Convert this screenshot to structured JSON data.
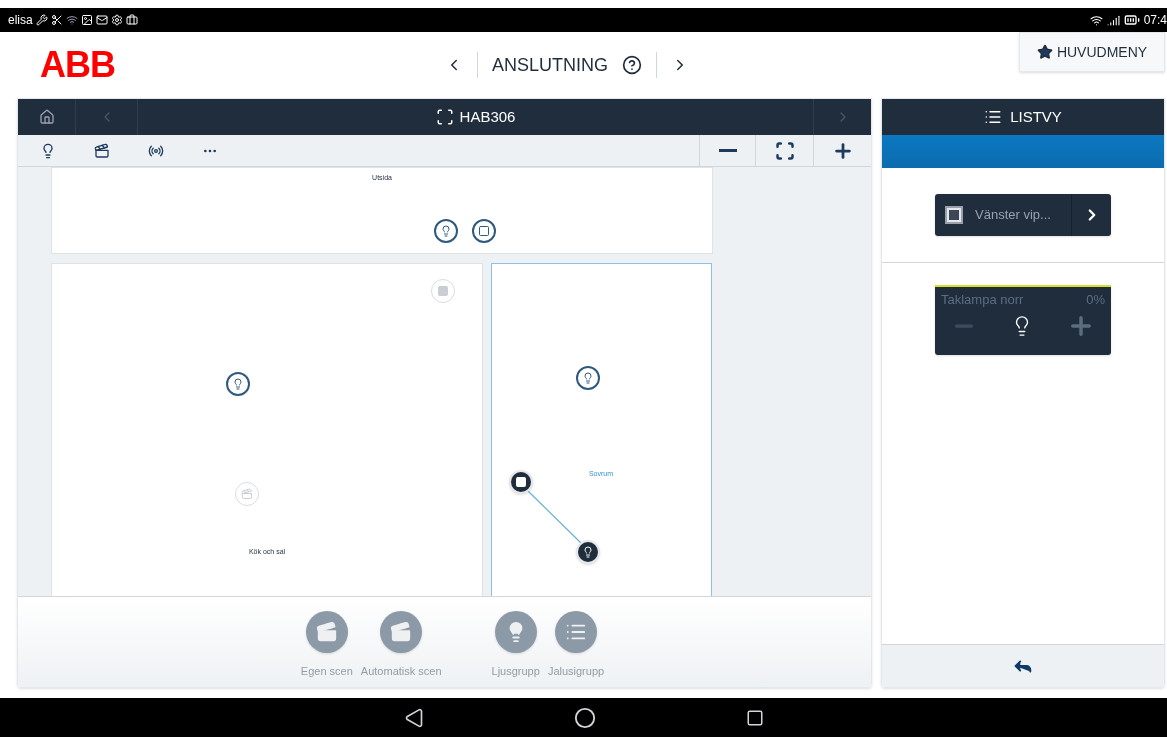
{
  "status_bar": {
    "carrier": "elisa",
    "time": "07:4"
  },
  "header": {
    "logo": "ABB",
    "title": "ANSLUTNING",
    "menu_button": "HUVUDMENY"
  },
  "floor_plan": {
    "title": "HAB306",
    "rooms": [
      {
        "name": "Utsida",
        "selected": false,
        "devices": [
          {
            "kind": "light",
            "disabled": false,
            "linked": false
          },
          {
            "kind": "socket",
            "disabled": false,
            "linked": false
          }
        ]
      },
      {
        "name": "Kök och sal",
        "selected": false,
        "devices": [
          {
            "kind": "switch",
            "disabled": true,
            "linked": false
          },
          {
            "kind": "light",
            "disabled": false,
            "linked": false
          },
          {
            "kind": "scene",
            "disabled": true,
            "linked": false
          }
        ]
      },
      {
        "name": "Sovrum",
        "selected": true,
        "devices": [
          {
            "kind": "light",
            "disabled": false,
            "linked": false
          },
          {
            "kind": "switch",
            "disabled": false,
            "linked": true
          },
          {
            "kind": "light",
            "disabled": false,
            "linked": true
          }
        ]
      }
    ],
    "palette": [
      {
        "kind": "scene",
        "label": "Egen scen",
        "disabled": true
      },
      {
        "kind": "scene",
        "label": "Automatisk scen",
        "disabled": true
      },
      {
        "kind": "light-group",
        "label": "Ljusgrupp",
        "disabled": true
      },
      {
        "kind": "blind-group",
        "label": "Jalusigrupp",
        "disabled": true
      }
    ]
  },
  "list_view": {
    "title": "LISTVY",
    "switch_button": "Vänster vip...",
    "dimmer": {
      "name": "Taklampa norr",
      "reading": "0%"
    }
  }
}
